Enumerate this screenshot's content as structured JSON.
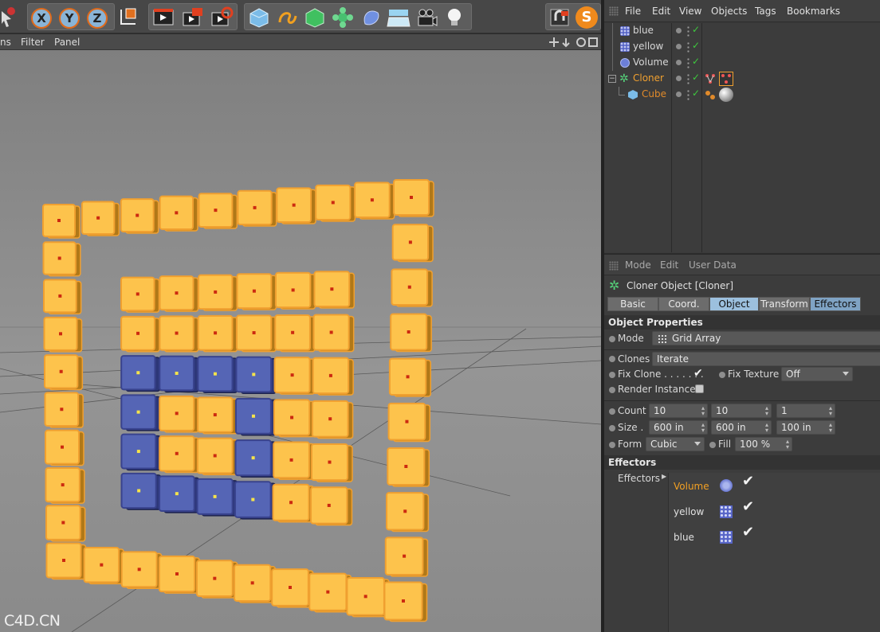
{
  "viewport_menu": {
    "partial_item": "ns",
    "filter": "Filter",
    "panel": "Panel"
  },
  "axis_buttons": {
    "x": "X",
    "y": "Y",
    "z": "Z"
  },
  "toolbar_right": {
    "script_badge": "S"
  },
  "object_manager": {
    "menu": [
      "File",
      "Edit",
      "View",
      "Objects",
      "Tags",
      "Bookmarks"
    ],
    "objects": [
      {
        "name": "blue",
        "color": "#d6d6d6"
      },
      {
        "name": "yellow",
        "color": "#d6d6d6"
      },
      {
        "name": "Volume",
        "color": "#d6d6d6"
      },
      {
        "name": "Cloner",
        "color": "#f0a030"
      },
      {
        "name": "Cube",
        "color": "#e08a2a"
      }
    ]
  },
  "attribute_manager": {
    "menu": [
      "Mode",
      "Edit",
      "User Data"
    ],
    "title": "Cloner Object [Cloner]",
    "tabs": [
      "Basic",
      "Coord.",
      "Object",
      "Transform",
      "Effectors"
    ],
    "active_tab": "Object",
    "object_properties": {
      "header": "Object Properties",
      "mode_label": "Mode",
      "mode_value": "Grid Array",
      "clones_label": "Clones",
      "clones_value": "Iterate",
      "fix_clone_label": "Fix Clone . . . . . . .",
      "fix_clone_checked": true,
      "fix_texture_label": "Fix Texture",
      "fix_texture_value": "Off",
      "render_instances_label": "Render Instances",
      "count_label": "Count",
      "count": [
        "10",
        "10",
        "1"
      ],
      "size_label": "Size  .",
      "size": [
        "600 in",
        "600 in",
        "100 in"
      ],
      "form_label": "Form",
      "form_value": "Cubic",
      "fill_label": "Fill",
      "fill_value": "100 %"
    },
    "effectors": {
      "header": "Effectors",
      "label": "Effectors",
      "items": [
        {
          "name": "Volume",
          "color": "#f2a023"
        },
        {
          "name": "yellow",
          "color": "#e0e0e0"
        },
        {
          "name": "blue",
          "color": "#e0e0e0"
        }
      ]
    }
  },
  "watermark": "C4D.CN",
  "colors": {
    "cube_yellow": "#fdc34c",
    "cube_blue": "#5565b5",
    "selection_orange": "#f0a030"
  },
  "icons": [
    "cursor-icon",
    "move-icon",
    "scale-icon",
    "coordinate-icon",
    "render-view-icon",
    "render-picture-icon",
    "render-settings-icon",
    "cube-icon",
    "spline-icon",
    "nurbs-icon",
    "cloner-icon",
    "deformer-icon",
    "floor-icon",
    "camera-icon",
    "light-icon",
    "magnet-icon"
  ]
}
